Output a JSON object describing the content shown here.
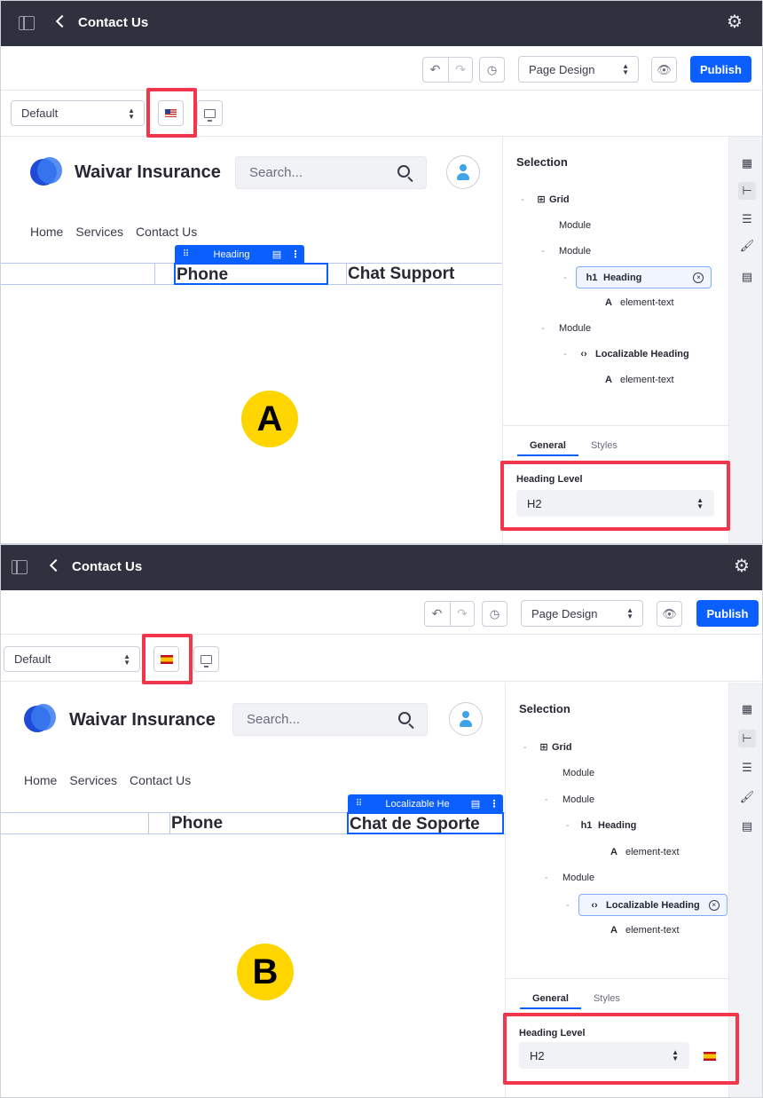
{
  "app": {
    "title": "Contact Us"
  },
  "toolbar": {
    "view_select": "Page Design",
    "publish_label": "Publish"
  },
  "subbar": {
    "experience_select": "Default"
  },
  "site": {
    "brand": "Waivar Insurance",
    "search_placeholder": "Search...",
    "nav": [
      "Home",
      "Services",
      "Contact Us"
    ]
  },
  "sidebar": {
    "selection_title": "Selection",
    "tree": {
      "grid": "Grid",
      "module": "Module",
      "heading": "Heading",
      "element_text": "element-text",
      "localizable_heading": "Localizable Heading"
    },
    "tabs": [
      "General",
      "Styles"
    ],
    "field_label": "Heading Level",
    "field_value": "H2"
  },
  "panelA": {
    "badge": "A",
    "chip_label": "Heading",
    "cells": [
      "Phone",
      "Chat Support"
    ],
    "flag_icon": "flag-us-icon"
  },
  "panelB": {
    "badge": "B",
    "chip_label": "Localizable He",
    "cells": [
      "Phone",
      "Chat de Soporte"
    ],
    "flag_icon": "flag-es-icon"
  },
  "colors": {
    "accent": "#0b5fff",
    "topbar": "#30313f",
    "highlight": "#f4364c",
    "badge": "#ffd500"
  }
}
